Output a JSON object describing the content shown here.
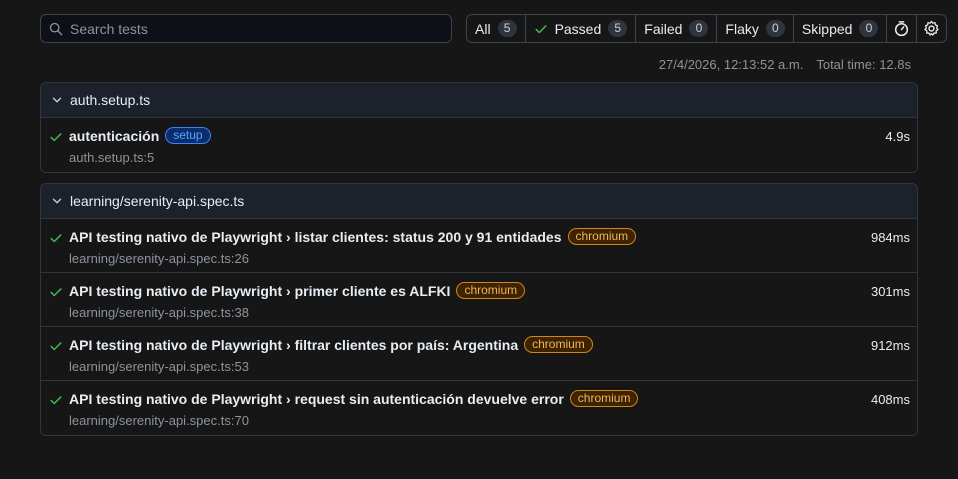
{
  "search": {
    "placeholder": "Search tests"
  },
  "filters": [
    {
      "label": "All",
      "count": "5"
    },
    {
      "label": "Passed",
      "count": "5"
    },
    {
      "label": "Failed",
      "count": "0"
    },
    {
      "label": "Flaky",
      "count": "0"
    },
    {
      "label": "Skipped",
      "count": "0"
    }
  ],
  "meta": {
    "timestamp": "27/4/2026, 12:13:52 a.m.",
    "total_time": "Total time: 12.8s"
  },
  "colors": {
    "passed": "#3fb950",
    "setup_label": "#58a6ff",
    "chromium_label": "#f0b45b"
  },
  "icons": {
    "search": "search-icon",
    "check": "check-icon",
    "clock": "stopwatch-icon",
    "settings": "gear-icon",
    "chevron": "chevron-down-icon"
  },
  "files": [
    {
      "name": "auth.setup.ts",
      "tests": [
        {
          "title": "autenticación",
          "label": "setup",
          "location": "auth.setup.ts:5",
          "duration": "4.9s"
        }
      ]
    },
    {
      "name": "learning/serenity-api.spec.ts",
      "tests": [
        {
          "title": "API testing nativo de Playwright › listar clientes: status 200 y 91 entidades",
          "label": "chromium",
          "location": "learning/serenity-api.spec.ts:26",
          "duration": "984ms"
        },
        {
          "title": "API testing nativo de Playwright › primer cliente es ALFKI",
          "label": "chromium",
          "location": "learning/serenity-api.spec.ts:38",
          "duration": "301ms"
        },
        {
          "title": "API testing nativo de Playwright › filtrar clientes por país: Argentina",
          "label": "chromium",
          "location": "learning/serenity-api.spec.ts:53",
          "duration": "912ms"
        },
        {
          "title": "API testing nativo de Playwright › request sin autenticación devuelve error",
          "label": "chromium",
          "location": "learning/serenity-api.spec.ts:70",
          "duration": "408ms"
        }
      ]
    }
  ]
}
